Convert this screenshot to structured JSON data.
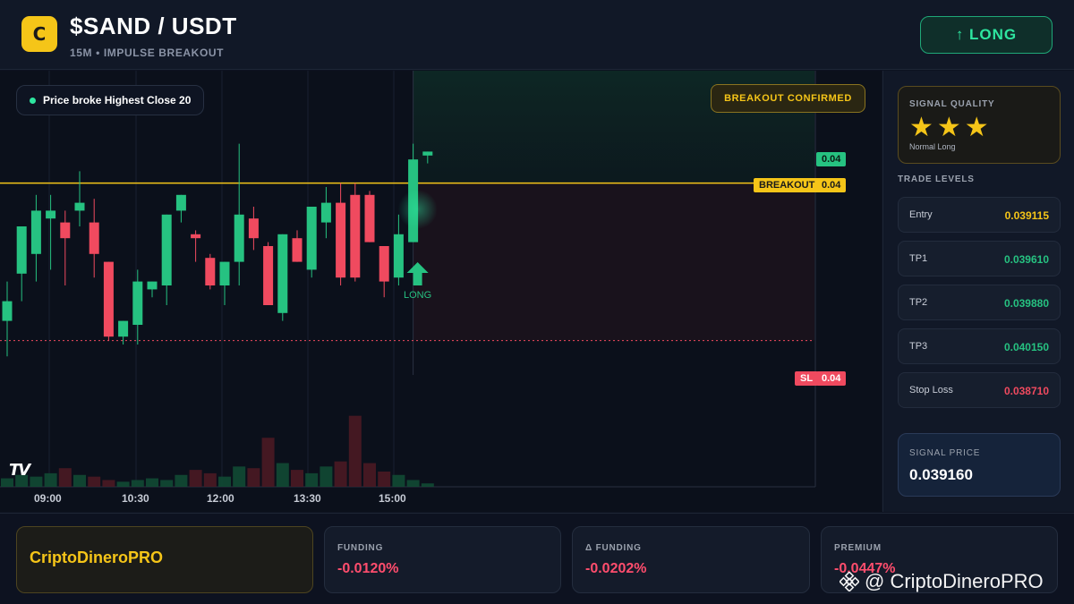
{
  "header": {
    "logo_letter": "C",
    "pair": "$SAND / USDT",
    "subtitle": "15M • IMPULSE BREAKOUT",
    "action_label": "↑ LONG"
  },
  "chart": {
    "note": "Price broke Highest Close 20",
    "badge": "BREAKOUT CONFIRMED",
    "signal_marker": "LONG",
    "tv_logo": "TV",
    "time_labels": [
      "09:00",
      "10:30",
      "12:00",
      "13:30",
      "15:00"
    ],
    "price_tags": {
      "current": "0.04",
      "breakout_label": "BREAKOUT",
      "breakout": "0.04",
      "sl_label": "SL",
      "sl": "0.04"
    },
    "colors": {
      "up": "#26c281",
      "down": "#f04a5f",
      "breakout_line": "#f5c518",
      "stop_line": "#f04a5f"
    }
  },
  "chart_data": {
    "type": "candlestick",
    "breakout_level": 0.03911,
    "stop_level": 0.03871,
    "signal_index": 28,
    "candles": [
      {
        "o": 0.03876,
        "h": 0.03886,
        "l": 0.03867,
        "c": 0.03881
      },
      {
        "o": 0.03888,
        "h": 0.03898,
        "l": 0.03881,
        "c": 0.039
      },
      {
        "o": 0.03893,
        "h": 0.03908,
        "l": 0.03886,
        "c": 0.03904
      },
      {
        "o": 0.03902,
        "h": 0.03908,
        "l": 0.03889,
        "c": 0.03904
      },
      {
        "o": 0.03901,
        "h": 0.03904,
        "l": 0.03885,
        "c": 0.03897
      },
      {
        "o": 0.03904,
        "h": 0.03914,
        "l": 0.039,
        "c": 0.03906
      },
      {
        "o": 0.03901,
        "h": 0.03907,
        "l": 0.03887,
        "c": 0.03893
      },
      {
        "o": 0.03891,
        "h": 0.03891,
        "l": 0.03871,
        "c": 0.03872
      },
      {
        "o": 0.03872,
        "h": 0.03873,
        "l": 0.0387,
        "c": 0.03876
      },
      {
        "o": 0.03875,
        "h": 0.03889,
        "l": 0.0387,
        "c": 0.03886
      },
      {
        "o": 0.03884,
        "h": 0.03886,
        "l": 0.03882,
        "c": 0.03886
      },
      {
        "o": 0.03885,
        "h": 0.03897,
        "l": 0.0388,
        "c": 0.03903
      },
      {
        "o": 0.03904,
        "h": 0.03907,
        "l": 0.03901,
        "c": 0.03908
      },
      {
        "o": 0.03898,
        "h": 0.03899,
        "l": 0.03891,
        "c": 0.03897
      },
      {
        "o": 0.03892,
        "h": 0.03893,
        "l": 0.03884,
        "c": 0.03885
      },
      {
        "o": 0.03885,
        "h": 0.03889,
        "l": 0.0388,
        "c": 0.03891
      },
      {
        "o": 0.03891,
        "h": 0.03921,
        "l": 0.03885,
        "c": 0.03903
      },
      {
        "o": 0.03902,
        "h": 0.03905,
        "l": 0.03894,
        "c": 0.03897
      },
      {
        "o": 0.03895,
        "h": 0.03896,
        "l": 0.0388,
        "c": 0.0388
      },
      {
        "o": 0.03878,
        "h": 0.03894,
        "l": 0.03876,
        "c": 0.03898
      },
      {
        "o": 0.03897,
        "h": 0.03899,
        "l": 0.03893,
        "c": 0.03891
      },
      {
        "o": 0.03889,
        "h": 0.03903,
        "l": 0.03887,
        "c": 0.03905
      },
      {
        "o": 0.03901,
        "h": 0.0391,
        "l": 0.03897,
        "c": 0.03906
      },
      {
        "o": 0.03906,
        "h": 0.03911,
        "l": 0.03885,
        "c": 0.03887
      },
      {
        "o": 0.03908,
        "h": 0.03911,
        "l": 0.03886,
        "c": 0.03887
      },
      {
        "o": 0.03908,
        "h": 0.03909,
        "l": 0.03896,
        "c": 0.03896
      },
      {
        "o": 0.03895,
        "h": 0.03895,
        "l": 0.03882,
        "c": 0.03886
      },
      {
        "o": 0.03887,
        "h": 0.03903,
        "l": 0.03885,
        "c": 0.03898
      },
      {
        "o": 0.03896,
        "h": 0.03921,
        "l": 0.03896,
        "c": 0.03917
      },
      {
        "o": 0.03918,
        "h": 0.03919,
        "l": 0.03916,
        "c": 0.03919
      }
    ],
    "volume": [
      10,
      14,
      12,
      16,
      22,
      14,
      12,
      8,
      6,
      8,
      10,
      8,
      14,
      20,
      16,
      12,
      24,
      22,
      58,
      28,
      20,
      16,
      24,
      30,
      84,
      28,
      18,
      14,
      8,
      4
    ]
  },
  "sidebar": {
    "quality_title": "SIGNAL QUALITY",
    "stars": "★★★",
    "quality_sub": "Normal Long",
    "levels_title": "TRADE LEVELS",
    "levels": [
      {
        "label": "Entry",
        "value": "0.039115",
        "color": "#f5c518"
      },
      {
        "label": "TP1",
        "value": "0.039610",
        "color": "#26c281"
      },
      {
        "label": "TP2",
        "value": "0.039880",
        "color": "#26c281"
      },
      {
        "label": "TP3",
        "value": "0.040150",
        "color": "#26c281"
      },
      {
        "label": "Stop Loss",
        "value": "0.038710",
        "color": "#f04a5f"
      }
    ],
    "signal_price_title": "SIGNAL PRICE",
    "signal_price": "0.039160"
  },
  "footer": {
    "brand": "CriptoDineroPRO",
    "metrics": [
      {
        "title": "FUNDING",
        "value": "-0.0120%"
      },
      {
        "title": "Δ FUNDING",
        "value": "-0.0202%"
      },
      {
        "title": "PREMIUM",
        "value": "-0.0447%"
      }
    ],
    "watermark": "@ CriptoDineroPRO"
  }
}
